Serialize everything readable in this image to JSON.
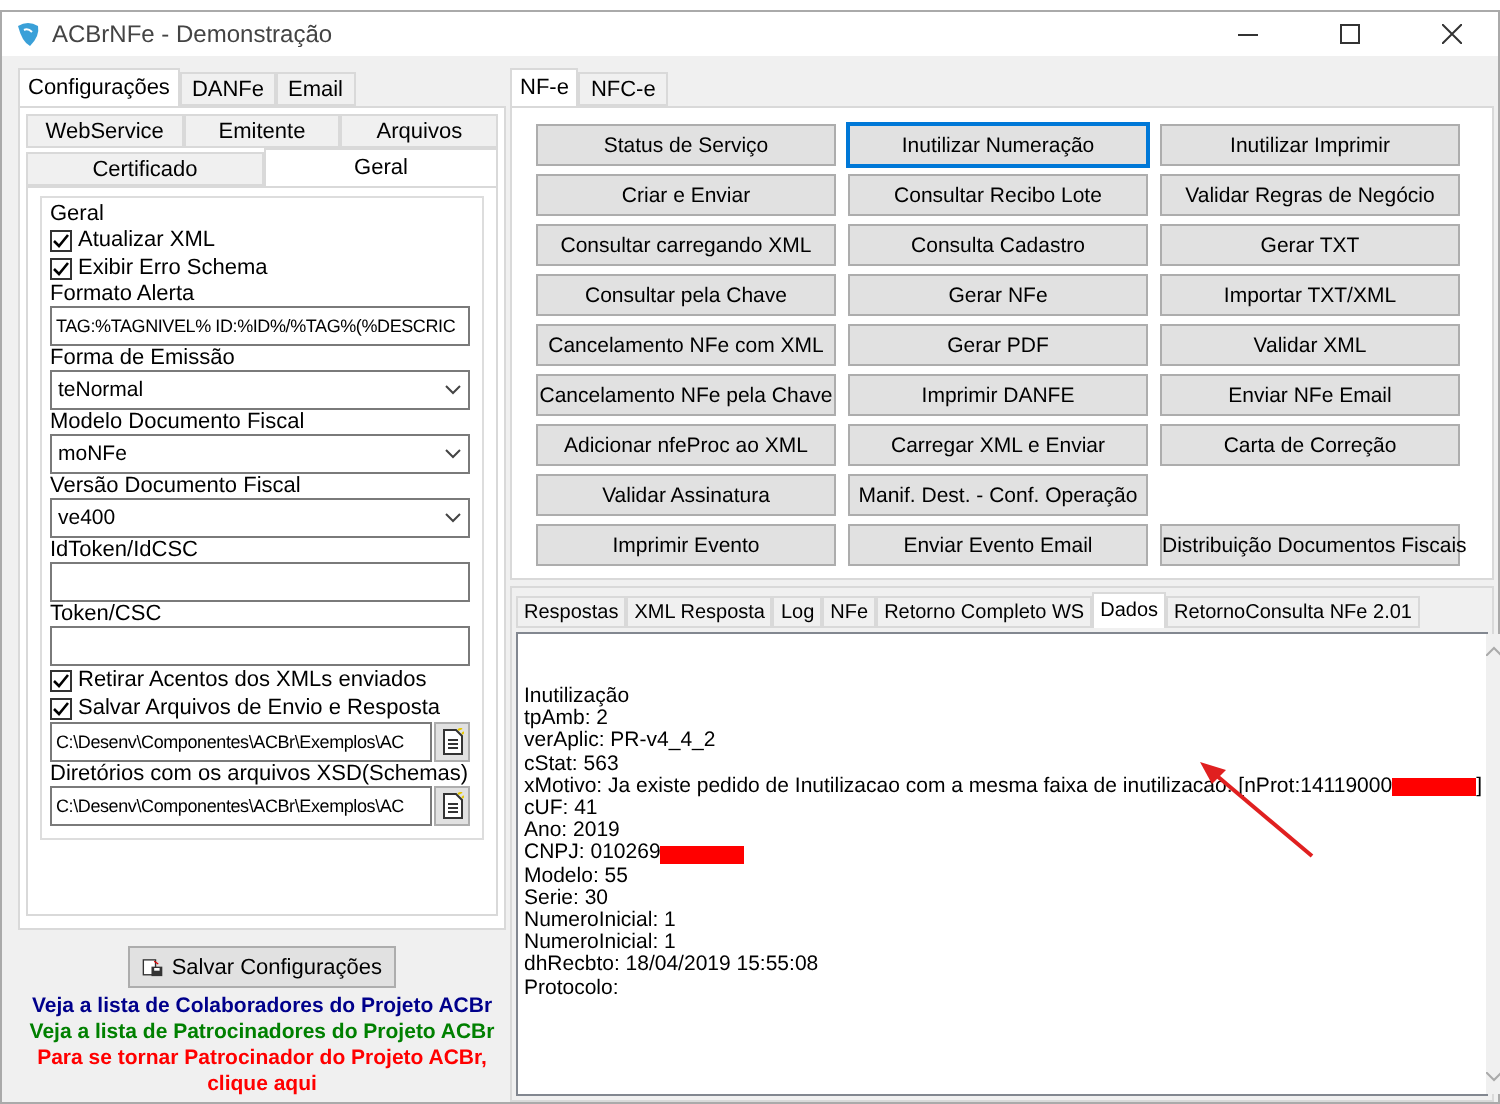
{
  "window": {
    "title": "ACBrNFe - Demonstração"
  },
  "left": {
    "tabs": [
      {
        "label": "Configurações",
        "selected": true
      },
      {
        "label": "DANFe",
        "selected": false
      },
      {
        "label": "Email",
        "selected": false
      }
    ],
    "subtabs": [
      [
        {
          "label": "WebService",
          "selected": false
        },
        {
          "label": "Emitente",
          "selected": false
        },
        {
          "label": "Arquivos",
          "selected": false
        }
      ],
      [
        {
          "label": "Certificado",
          "selected": false
        },
        {
          "label": "Geral",
          "selected": true
        }
      ]
    ],
    "group": {
      "title": "Geral",
      "fields": [
        {
          "kind": "checkbox",
          "label": "Atualizar XML",
          "checked": true
        },
        {
          "kind": "checkbox",
          "label": "Exibir Erro Schema",
          "checked": true
        },
        {
          "kind": "label",
          "label": "Formato Alerta"
        },
        {
          "kind": "input",
          "value": "TAG:%TAGNIVEL% ID:%ID%/%TAG%(%DESCRIC"
        },
        {
          "kind": "label",
          "label": "Forma de Emissão"
        },
        {
          "kind": "select",
          "value": "teNormal"
        },
        {
          "kind": "label",
          "label": "Modelo Documento Fiscal"
        },
        {
          "kind": "select",
          "value": "moNFe"
        },
        {
          "kind": "label",
          "label": "Versão Documento Fiscal"
        },
        {
          "kind": "select",
          "value": "ve400"
        },
        {
          "kind": "label",
          "label": "IdToken/IdCSC"
        },
        {
          "kind": "input"
        },
        {
          "kind": "label",
          "label": "Token/CSC"
        },
        {
          "kind": "input"
        },
        {
          "kind": "checkbox",
          "label": "Retirar Acentos dos XMLs enviados",
          "checked": true
        },
        {
          "kind": "checkbox",
          "label": "Salvar Arquivos de Envio e Resposta",
          "checked": true
        },
        {
          "kind": "path",
          "value": "C:\\Desenv\\Componentes\\ACBr\\Exemplos\\AC"
        },
        {
          "kind": "label",
          "label": "Diretórios com os arquivos XSD(Schemas)"
        },
        {
          "kind": "path",
          "value": "C:\\Desenv\\Componentes\\ACBr\\Exemplos\\AC"
        }
      ]
    },
    "save_button": "Salvar Configurações",
    "links": [
      {
        "text": "Veja a lista de Colaboradores do Projeto ACBr",
        "color": "#00008b"
      },
      {
        "text": "Veja a lista de Patrocinadores do Projeto ACBr",
        "color": "#008000"
      },
      {
        "text": "Para se tornar Patrocinador do Projeto ACBr, clique aqui",
        "color": "#ff0000"
      }
    ]
  },
  "right": {
    "tabs": [
      {
        "label": "NF-e",
        "selected": true
      },
      {
        "label": "NFC-e",
        "selected": false
      }
    ],
    "buttons": [
      {
        "label": "Status de Serviço",
        "focused": false
      },
      {
        "label": "Inutilizar Numeração",
        "focused": true
      },
      {
        "label": "Inutilizar Imprimir",
        "focused": false
      },
      {
        "label": "Criar e Enviar",
        "focused": false
      },
      {
        "label": "Consultar Recibo Lote",
        "focused": false
      },
      {
        "label": "Validar Regras de Negócio",
        "focused": false
      },
      {
        "label": "Consultar carregando XML",
        "focused": false
      },
      {
        "label": "Consulta Cadastro",
        "focused": false
      },
      {
        "label": "Gerar TXT",
        "focused": false
      },
      {
        "label": "Consultar pela Chave",
        "focused": false
      },
      {
        "label": "Gerar NFe",
        "focused": false
      },
      {
        "label": "Importar TXT/XML",
        "focused": false
      },
      {
        "label": "Cancelamento NFe com XML",
        "focused": false
      },
      {
        "label": "Gerar PDF",
        "focused": false
      },
      {
        "label": "Validar XML",
        "focused": false
      },
      {
        "label": "Cancelamento NFe pela Chave",
        "focused": false
      },
      {
        "label": "Imprimir DANFE",
        "focused": false
      },
      {
        "label": "Enviar NFe Email",
        "focused": false
      },
      {
        "label": "Adicionar nfeProc ao XML",
        "focused": false
      },
      {
        "label": "Carregar XML e Enviar",
        "focused": false
      },
      {
        "label": "Carta de Correção",
        "focused": false
      },
      {
        "label": "Validar Assinatura",
        "focused": false
      },
      {
        "label": "Manif. Dest. - Conf. Operação",
        "focused": false
      },
      {
        "kind": "empty"
      },
      {
        "label": "Imprimir Evento",
        "focused": false
      },
      {
        "label": "Enviar Evento Email",
        "focused": false
      },
      {
        "label": "Distribuição Documentos Fiscais",
        "focused": false
      }
    ],
    "result_tabs": [
      {
        "label": "Respostas",
        "selected": false
      },
      {
        "label": "XML Resposta",
        "selected": false
      },
      {
        "label": "Log",
        "selected": false
      },
      {
        "label": "NFe",
        "selected": false
      },
      {
        "label": "Retorno Completo WS",
        "selected": false
      },
      {
        "label": "Dados",
        "selected": true
      },
      {
        "label": "RetornoConsulta NFe 2.01",
        "selected": false
      }
    ],
    "lines": [
      {
        "text": "Inutilização"
      },
      {
        "text": "tpAmb: 2"
      },
      {
        "text": "verAplic: PR-v4_4_2"
      },
      {
        "text": "cStat: 563"
      },
      {
        "text": "xMotivo: Ja existe pedido de Inutilizacao com a mesma faixa de inutilizacao. [nProt:14119000",
        "redacted": true,
        "suffix": "]"
      },
      {
        "text": "cUF: 41"
      },
      {
        "text": "Ano: 2019"
      },
      {
        "text": "CNPJ: 010269",
        "redacted": true
      },
      {
        "text": "Modelo: 55"
      },
      {
        "text": "Serie: 30"
      },
      {
        "text": "NumeroInicial: 1"
      },
      {
        "text": "NumeroInicial: 1"
      },
      {
        "text": "dhRecbto: 18/04/2019 15:55:08"
      },
      {
        "text": "Protocolo:"
      }
    ]
  }
}
